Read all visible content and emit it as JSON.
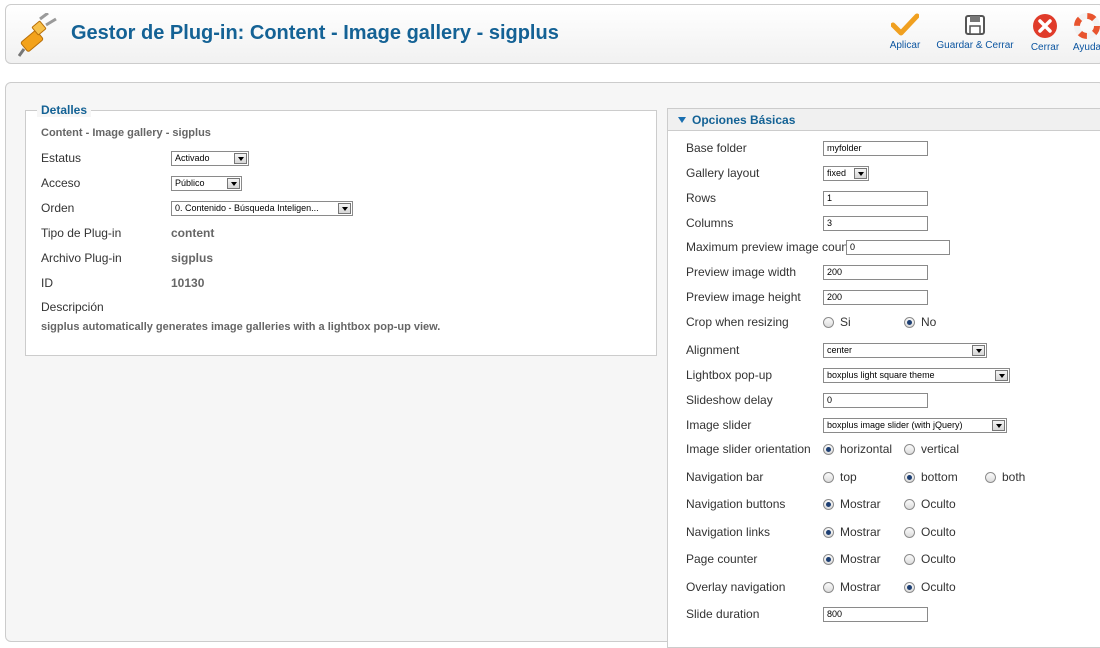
{
  "header": {
    "title": "Gestor de Plug-in: Content - Image gallery - sigplus",
    "toolbar": {
      "apply": "Aplicar",
      "save_close": "Guardar & Cerrar",
      "close": "Cerrar",
      "help": "Ayuda"
    }
  },
  "details": {
    "legend": "Detalles",
    "subtitle": "Content - Image gallery - sigplus",
    "status_label": "Estatus",
    "status_value": "Activado",
    "access_label": "Acceso",
    "access_value": "Público",
    "order_label": "Orden",
    "order_value": "0. Contenido - Búsqueda Inteligen...",
    "type_label": "Tipo de Plug-in",
    "type_value": "content",
    "file_label": "Archivo Plug-in",
    "file_value": "sigplus",
    "id_label": "ID",
    "id_value": "10130",
    "description_label": "Descripción",
    "description_text": "sigplus automatically generates image galleries with a lightbox pop-up view."
  },
  "options": {
    "header": "Opciones Básicas",
    "base_folder": {
      "label": "Base folder",
      "value": "myfolder"
    },
    "gallery_layout": {
      "label": "Gallery layout",
      "value": "fixed"
    },
    "rows": {
      "label": "Rows",
      "value": "1"
    },
    "columns": {
      "label": "Columns",
      "value": "3"
    },
    "max_preview": {
      "label": "Maximum preview image count",
      "value": "0"
    },
    "preview_width": {
      "label": "Preview image width",
      "value": "200"
    },
    "preview_height": {
      "label": "Preview image height",
      "value": "200"
    },
    "crop": {
      "label": "Crop when resizing",
      "opt1": "Si",
      "opt2": "No",
      "selected": "No"
    },
    "alignment": {
      "label": "Alignment",
      "value": "center"
    },
    "lightbox": {
      "label": "Lightbox pop-up",
      "value": "boxplus light square theme"
    },
    "slideshow_delay": {
      "label": "Slideshow delay",
      "value": "0"
    },
    "image_slider": {
      "label": "Image slider",
      "value": "boxplus image slider (with jQuery)"
    },
    "slider_orientation": {
      "label": "Image slider orientation",
      "opt1": "horizontal",
      "opt2": "vertical",
      "selected": "horizontal"
    },
    "nav_bar": {
      "label": "Navigation bar",
      "opt1": "top",
      "opt2": "bottom",
      "opt3": "both",
      "selected": "bottom"
    },
    "nav_buttons": {
      "label": "Navigation buttons",
      "opt1": "Mostrar",
      "opt2": "Oculto",
      "selected": "Mostrar"
    },
    "nav_links": {
      "label": "Navigation links",
      "opt1": "Mostrar",
      "opt2": "Oculto",
      "selected": "Mostrar"
    },
    "page_counter": {
      "label": "Page counter",
      "opt1": "Mostrar",
      "opt2": "Oculto",
      "selected": "Mostrar"
    },
    "overlay_nav": {
      "label": "Overlay navigation",
      "opt1": "Mostrar",
      "opt2": "Oculto",
      "selected": "Oculto"
    },
    "slide_duration": {
      "label": "Slide duration",
      "value": "800"
    }
  },
  "colors": {
    "title_blue": "#146295",
    "link_blue": "#0b55a0",
    "apply_orange": "#f0a020",
    "close_red": "#e03b2a"
  },
  "icons": [
    "plug-icon",
    "checkmark-icon",
    "floppy-disk-icon",
    "close-circle-icon",
    "help-lifebuoy-icon",
    "triangle-down-icon"
  ]
}
